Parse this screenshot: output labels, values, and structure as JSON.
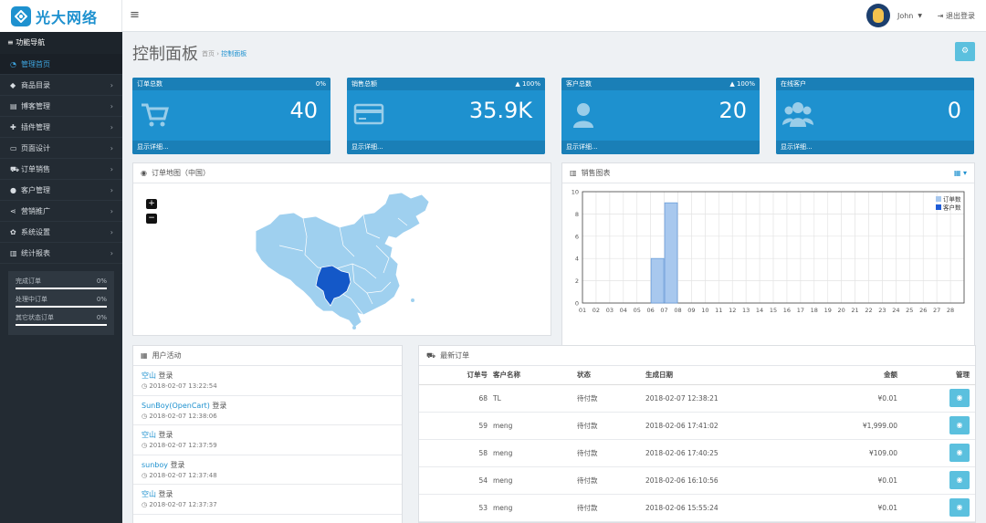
{
  "brand": {
    "name": "光大网络"
  },
  "header": {
    "user_name": "John",
    "logout_label": "退出登录"
  },
  "sidebar": {
    "heading": "功能导航",
    "items": [
      {
        "label": "管理首页",
        "icon": "dashboard-icon",
        "active": true
      },
      {
        "label": "商品目录",
        "icon": "tag-icon"
      },
      {
        "label": "博客管理",
        "icon": "book-icon"
      },
      {
        "label": "插件管理",
        "icon": "puzzle-icon"
      },
      {
        "label": "页面设计",
        "icon": "monitor-icon"
      },
      {
        "label": "订单销售",
        "icon": "cart-icon"
      },
      {
        "label": "客户管理",
        "icon": "user-icon"
      },
      {
        "label": "营销推广",
        "icon": "share-icon"
      },
      {
        "label": "系统设置",
        "icon": "cog-icon"
      },
      {
        "label": "统计报表",
        "icon": "bar-chart-icon"
      }
    ],
    "progress": [
      {
        "label": "完成订单",
        "value": "0%"
      },
      {
        "label": "处理中订单",
        "value": "0%"
      },
      {
        "label": "其它状态订单",
        "value": "0%"
      }
    ]
  },
  "page": {
    "title": "控制面板",
    "breadcrumb_home": "首页",
    "breadcrumb_sep": "›",
    "breadcrumb_current": "控制面板"
  },
  "tiles": [
    {
      "title": "订单总数",
      "change": "0%",
      "value": "40",
      "footer": "显示详细...",
      "icon": "cart-icon"
    },
    {
      "title": "销售总额",
      "change": "▲ 100%",
      "value": "35.9K",
      "footer": "显示详细...",
      "icon": "credit-card-icon"
    },
    {
      "title": "客户总数",
      "change": "▲ 100%",
      "value": "20",
      "footer": "显示详细...",
      "icon": "user-icon"
    },
    {
      "title": "在线客户",
      "change": "",
      "value": "0",
      "footer": "显示详细...",
      "icon": "users-icon"
    }
  ],
  "map_panel": {
    "title": "订单地图（中国）",
    "zoom_in": "+",
    "zoom_out": "−"
  },
  "chart_panel": {
    "title": "销售图表"
  },
  "chart_data": {
    "type": "bar",
    "categories": [
      "01",
      "02",
      "03",
      "04",
      "05",
      "06",
      "07",
      "08",
      "09",
      "10",
      "11",
      "12",
      "13",
      "14",
      "15",
      "16",
      "17",
      "18",
      "19",
      "20",
      "21",
      "22",
      "23",
      "24",
      "25",
      "26",
      "27",
      "28"
    ],
    "series": [
      {
        "name": "订单数",
        "color": "#a8c8ee",
        "values": [
          0,
          0,
          0,
          0,
          0,
          4,
          9,
          0,
          0,
          0,
          0,
          0,
          0,
          0,
          0,
          0,
          0,
          0,
          0,
          0,
          0,
          0,
          0,
          0,
          0,
          0,
          0,
          0
        ]
      },
      {
        "name": "客户数",
        "color": "#1e5bd6",
        "values": [
          0,
          0,
          0,
          0,
          0,
          0,
          0,
          0,
          0,
          0,
          0,
          0,
          0,
          0,
          0,
          0,
          0,
          0,
          0,
          0,
          0,
          0,
          0,
          0,
          0,
          0,
          0,
          0
        ]
      }
    ],
    "yticks": [
      "0",
      "2",
      "4",
      "6",
      "8",
      "10"
    ],
    "ylim": [
      0,
      10
    ],
    "grid": true,
    "legend_position": "top-right"
  },
  "activity_panel": {
    "title": "用户活动",
    "items": [
      {
        "user": "空山",
        "action": "登录",
        "time": "2018-02-07 13:22:54"
      },
      {
        "user": "SunBoy(OpenCart)",
        "action": "登录",
        "time": "2018-02-07 12:38:06"
      },
      {
        "user": "空山",
        "action": "登录",
        "time": "2018-02-07 12:37:59"
      },
      {
        "user": "sunboy",
        "action": "登录",
        "time": "2018-02-07 12:37:48"
      },
      {
        "user": "空山",
        "action": "登录",
        "time": "2018-02-07 12:37:37"
      }
    ]
  },
  "orders_panel": {
    "title": "最新订单",
    "columns": {
      "id": "订单号",
      "customer": "客户名称",
      "status": "状态",
      "date": "生成日期",
      "total": "金额",
      "action": "管理"
    },
    "rows": [
      {
        "id": "68",
        "customer": "TL",
        "status": "待付款",
        "date": "2018-02-07 12:38:21",
        "total": "¥0.01"
      },
      {
        "id": "59",
        "customer": "meng",
        "status": "待付款",
        "date": "2018-02-06 17:41:02",
        "total": "¥1,999.00"
      },
      {
        "id": "58",
        "customer": "meng",
        "status": "待付款",
        "date": "2018-02-06 17:40:25",
        "total": "¥109.00"
      },
      {
        "id": "54",
        "customer": "meng",
        "status": "待付款",
        "date": "2018-02-06 16:10:56",
        "total": "¥0.01"
      },
      {
        "id": "53",
        "customer": "meng",
        "status": "待付款",
        "date": "2018-02-06 15:55:24",
        "total": "¥0.01"
      }
    ]
  }
}
